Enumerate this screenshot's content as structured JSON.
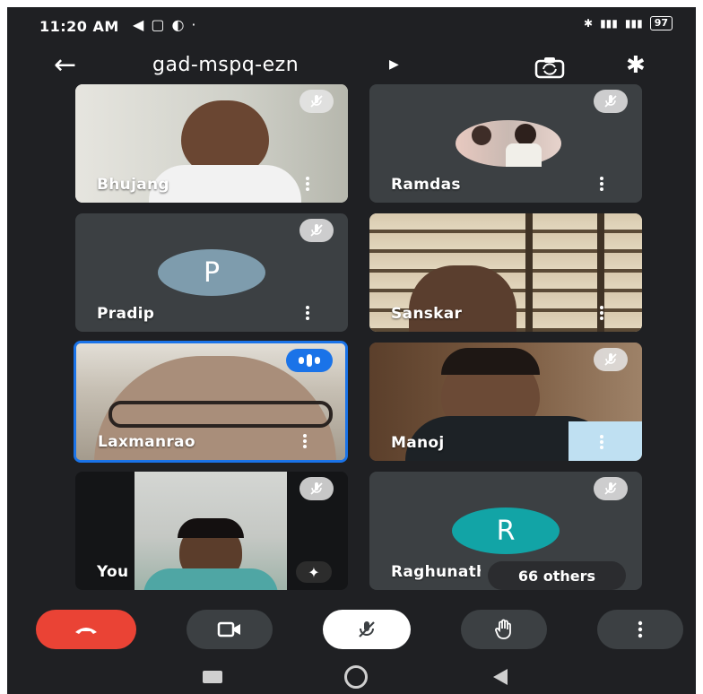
{
  "status_bar": {
    "time": "11:20 AM",
    "battery": "97"
  },
  "meeting": {
    "code": "gad-mspq-ezn"
  },
  "participants": [
    {
      "name": "Bhujang",
      "muted": true,
      "type": "video"
    },
    {
      "name": "Ramdas",
      "muted": true,
      "type": "photo-avatar"
    },
    {
      "name": "Pradip",
      "muted": true,
      "type": "initial",
      "initial": "P",
      "avatar_color": "#7e9cad"
    },
    {
      "name": "Sanskar",
      "muted": false,
      "type": "video"
    },
    {
      "name": "Laxmanrao",
      "muted": false,
      "speaking": true,
      "type": "video"
    },
    {
      "name": "Manoj",
      "muted": true,
      "type": "video"
    },
    {
      "name": "You",
      "muted": true,
      "type": "video"
    },
    {
      "name": "Raghunath",
      "muted": true,
      "type": "initial",
      "initial": "R",
      "avatar_color": "#12a4a6"
    }
  ],
  "others_label": "66 others",
  "colors": {
    "background": "#1f2023",
    "tile": "#3c4043",
    "end_call": "#ea4335",
    "speaking": "#1a73e8"
  },
  "controls": [
    {
      "name": "end-call",
      "icon": "phone-hangup-icon"
    },
    {
      "name": "camera",
      "icon": "video-camera-icon"
    },
    {
      "name": "microphone",
      "icon": "mic-off-icon"
    },
    {
      "name": "raise-hand",
      "icon": "hand-icon"
    },
    {
      "name": "more-options",
      "icon": "more-vert-icon"
    }
  ]
}
